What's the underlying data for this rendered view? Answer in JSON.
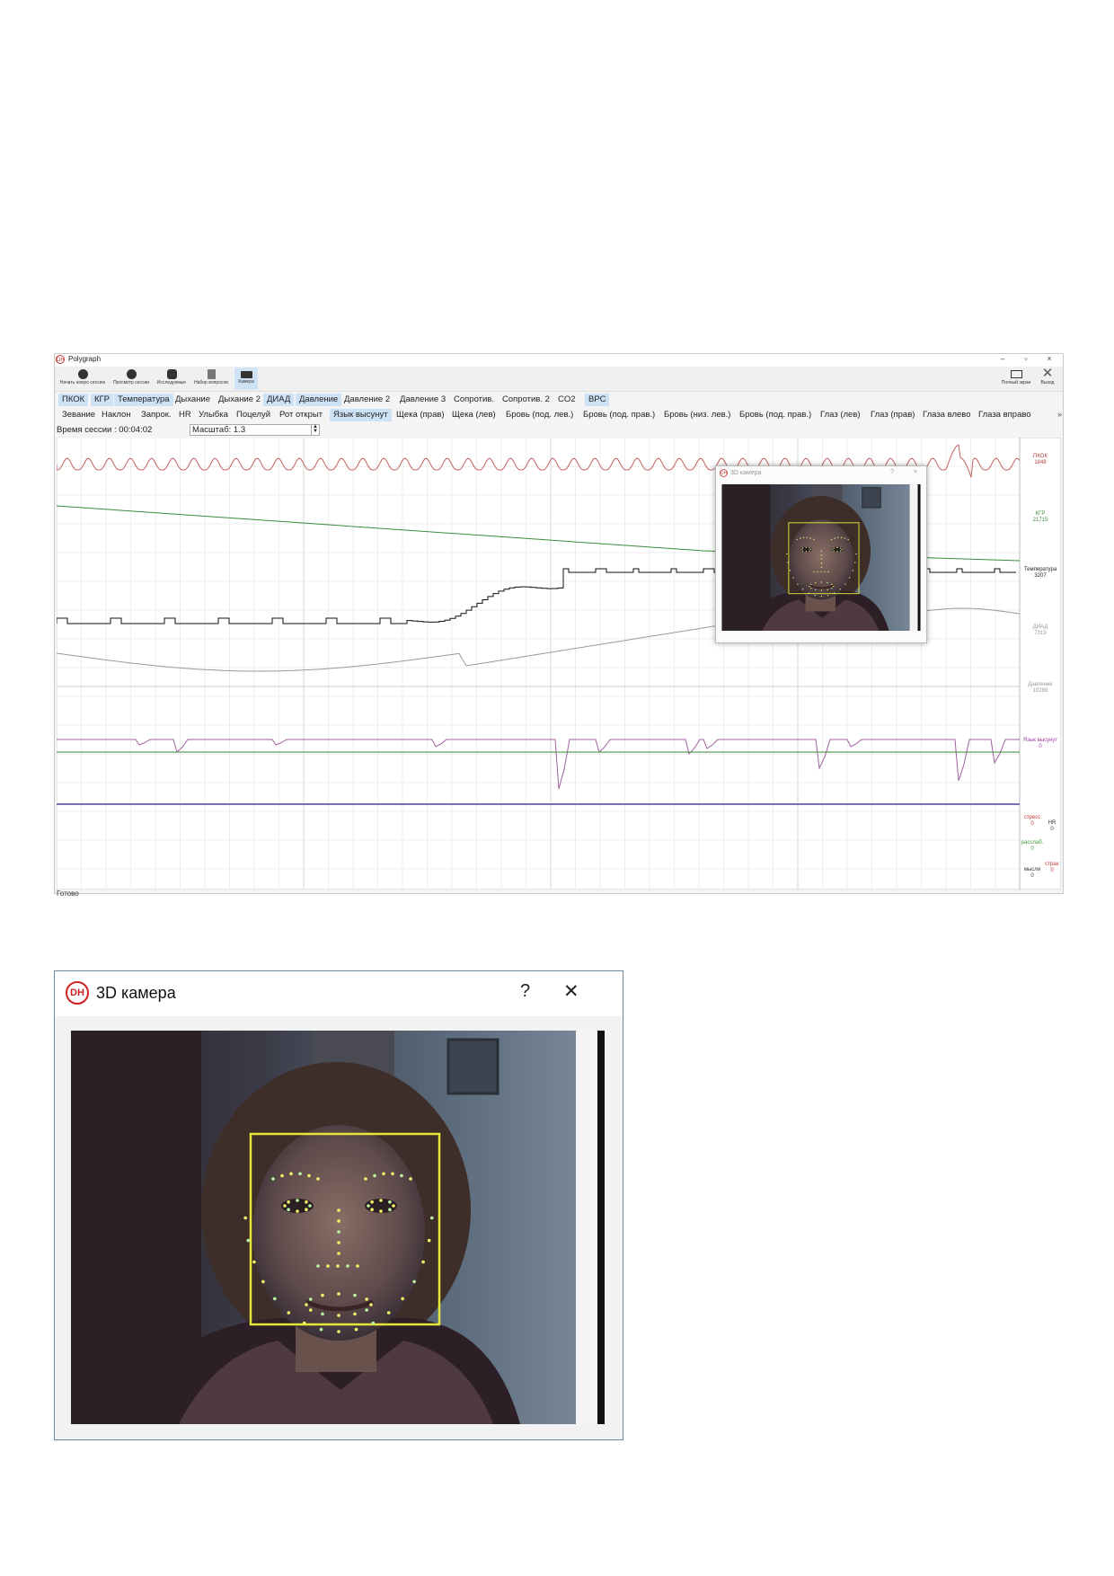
{
  "app": {
    "title": "Polygraph",
    "window_controls": [
      "–",
      "▫",
      "×"
    ],
    "toolbar": [
      {
        "label": "Начать новую сессию",
        "icon": "play-icon",
        "active": false
      },
      {
        "label": "Просмотр сессии",
        "icon": "info-icon",
        "active": false
      },
      {
        "label": "Исследуемые",
        "icon": "users-icon",
        "active": false
      },
      {
        "label": "Набор вопросов",
        "icon": "clipboard-icon",
        "active": false
      },
      {
        "label": "Камера",
        "icon": "camera-icon",
        "active": true
      }
    ],
    "toolbar_right": [
      {
        "label": "Полный экран",
        "icon": "fullscreen-icon"
      },
      {
        "label": "Выход",
        "icon": "exit-icon"
      }
    ],
    "channels_row1": [
      {
        "label": "ПКОК",
        "on": true
      },
      {
        "label": "КГР",
        "on": true
      },
      {
        "label": "Температура",
        "on": true
      },
      {
        "label": "Дыхание",
        "on": false
      },
      {
        "label": "Дыхание 2",
        "on": false
      },
      {
        "label": "ДИАД",
        "on": true
      },
      {
        "label": "Давление",
        "on": true
      },
      {
        "label": "Давление 2",
        "on": false
      },
      {
        "label": "Давление 3",
        "on": false
      },
      {
        "label": "Сопротив.",
        "on": false
      },
      {
        "label": "Сопротив. 2",
        "on": false
      },
      {
        "label": "CO2",
        "on": false
      },
      {
        "label": "ВРС",
        "on": true
      }
    ],
    "channels_row2": [
      {
        "label": "Зевание",
        "on": false
      },
      {
        "label": "Наклон",
        "on": false
      },
      {
        "label": "Запрок.",
        "on": false
      },
      {
        "label": "HR",
        "on": false
      },
      {
        "label": "Улыбка",
        "on": false
      },
      {
        "label": "Поцелуй",
        "on": false
      },
      {
        "label": "Рот открыт",
        "on": false
      },
      {
        "label": "Язык высунут",
        "on": true
      },
      {
        "label": "Щека (прав)",
        "on": false
      },
      {
        "label": "Щека (лев)",
        "on": false
      },
      {
        "label": "Бровь (под. лев.)",
        "on": false
      },
      {
        "label": "Бровь (под. прав.)",
        "on": false
      },
      {
        "label": "Бровь (низ. лев.)",
        "on": false
      },
      {
        "label": "Бровь (под. прав.)",
        "on": false
      },
      {
        "label": "Глаз (лев)",
        "on": false
      },
      {
        "label": "Глаз (прав)",
        "on": false
      },
      {
        "label": "Глаза влево",
        "on": false
      },
      {
        "label": "Глаза вправо",
        "on": false
      }
    ],
    "more": "»",
    "session_time": "Время сессии : 00:04:02",
    "scale_value": "Масштаб: 1.3",
    "status": "Готово",
    "channel_labels": [
      {
        "name": "ПКОК",
        "value": "1848",
        "color": "#b04040"
      },
      {
        "name": "КГР",
        "value": "21715",
        "color": "#3a8a3a"
      },
      {
        "name": "Температура",
        "value": "3207",
        "color": "#222222"
      },
      {
        "name": "ДИАД",
        "value": "7319",
        "color": "#999999"
      },
      {
        "name": "Давление",
        "value": "10288",
        "color": "#999999"
      },
      {
        "name": "Язык высунут",
        "value": "0",
        "color": "#a040a0"
      }
    ],
    "bottom_labels": [
      {
        "name": "стресс",
        "value": "0",
        "color": "#c03030"
      },
      {
        "name": "HR",
        "value": "0",
        "color": "#333333"
      },
      {
        "name": "расслаб.",
        "value": "0",
        "color": "#3a9a3a"
      },
      {
        "name": "мысли",
        "value": "0",
        "color": "#333333"
      },
      {
        "name": "страх",
        "value": "0",
        "color": "#c03030"
      }
    ]
  },
  "camera_small": {
    "title": "3D камера",
    "help": "?",
    "close": "×"
  },
  "camera_large": {
    "title": "3D камера",
    "help": "?",
    "close": "✕",
    "logo": "DH"
  }
}
